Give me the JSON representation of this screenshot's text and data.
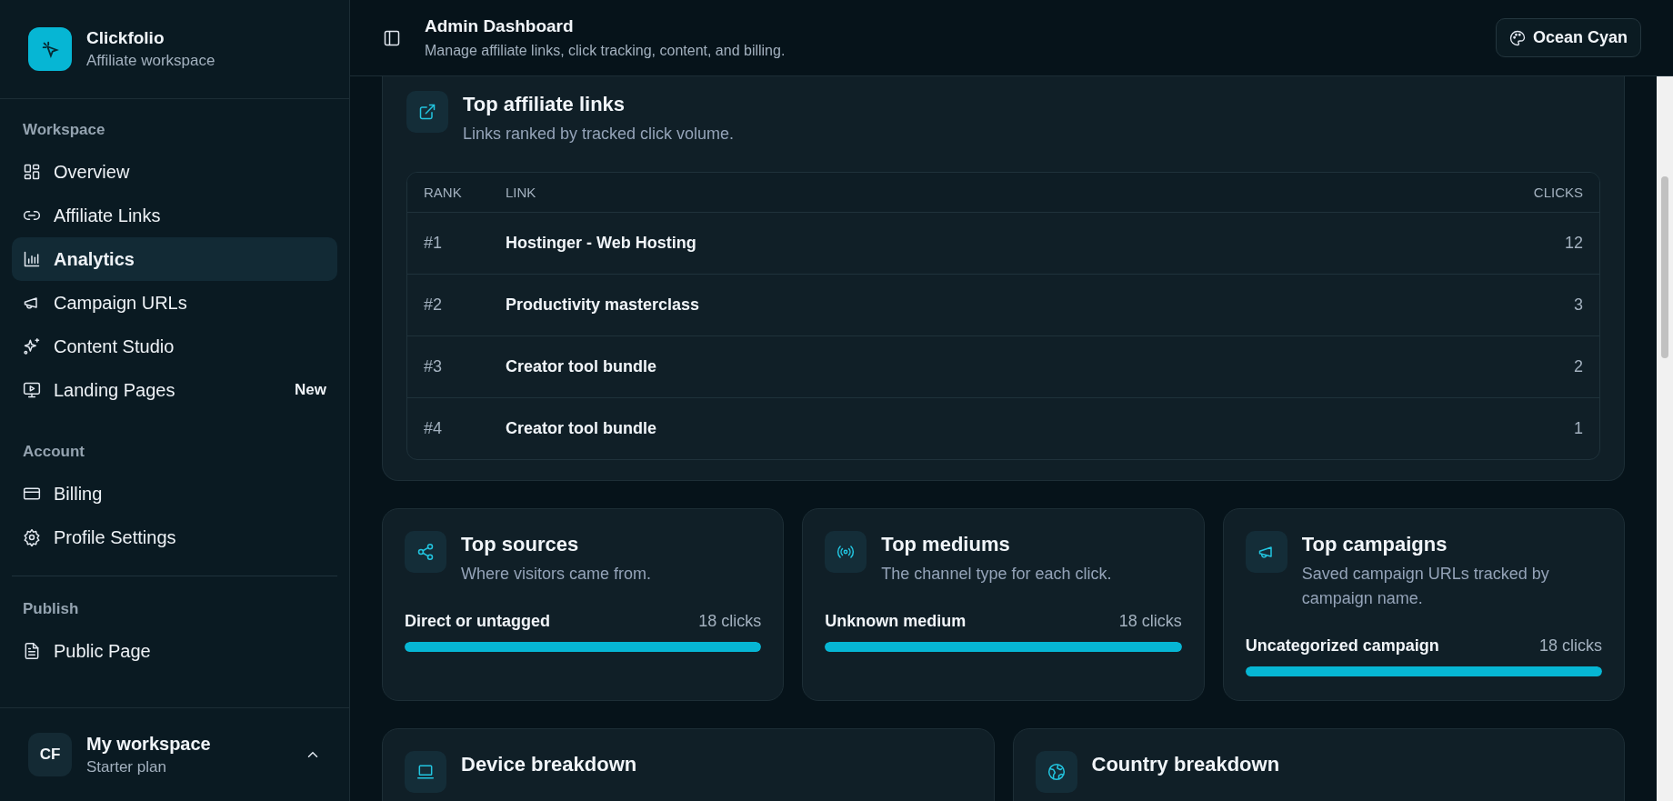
{
  "brand": {
    "name": "Clickfolio",
    "subtitle": "Affiliate workspace"
  },
  "sidebar": {
    "sections": [
      {
        "title": "Workspace",
        "items": [
          {
            "label": "Overview",
            "selected": false
          },
          {
            "label": "Affiliate Links",
            "selected": false
          },
          {
            "label": "Analytics",
            "selected": true
          },
          {
            "label": "Campaign URLs",
            "selected": false
          },
          {
            "label": "Content Studio",
            "selected": false
          },
          {
            "label": "Landing Pages",
            "selected": false,
            "badge": "New"
          }
        ]
      },
      {
        "title": "Account",
        "items": [
          {
            "label": "Billing",
            "selected": false
          },
          {
            "label": "Profile Settings",
            "selected": false
          }
        ]
      },
      {
        "title": "Publish",
        "items": [
          {
            "label": "Public Page",
            "selected": false
          }
        ]
      }
    ]
  },
  "user": {
    "initials": "CF",
    "name": "My workspace",
    "plan": "Starter plan"
  },
  "header": {
    "title": "Admin Dashboard",
    "subtitle": "Manage affiliate links, click tracking, content, and billing.",
    "theme_button": "Ocean Cyan"
  },
  "top_links": {
    "title": "Top affiliate links",
    "subtitle": "Links ranked by tracked click volume.",
    "columns": [
      "RANK",
      "LINK",
      "CLICKS"
    ],
    "rows": [
      {
        "rank": "#1",
        "link": "Hostinger - Web Hosting",
        "clicks": "12"
      },
      {
        "rank": "#2",
        "link": "Productivity masterclass",
        "clicks": "3"
      },
      {
        "rank": "#3",
        "link": "Creator tool bundle",
        "clicks": "2"
      },
      {
        "rank": "#4",
        "link": "Creator tool bundle",
        "clicks": "1"
      }
    ]
  },
  "breakdowns": [
    {
      "title": "Top sources",
      "subtitle": "Where visitors came from.",
      "items": [
        {
          "label": "Direct or untagged",
          "reading": "18 clicks",
          "level": 1
        }
      ]
    },
    {
      "title": "Top mediums",
      "subtitle": "The channel type for each click.",
      "items": [
        {
          "label": "Unknown medium",
          "reading": "18 clicks",
          "level": 1
        }
      ]
    },
    {
      "title": "Top campaigns",
      "subtitle": "Saved campaign URLs tracked by campaign name.",
      "items": [
        {
          "label": "Uncategorized campaign",
          "reading": "18 clicks",
          "level": 1
        }
      ]
    }
  ],
  "bottom_cards": [
    {
      "title": "Device breakdown"
    },
    {
      "title": "Country breakdown"
    }
  ]
}
